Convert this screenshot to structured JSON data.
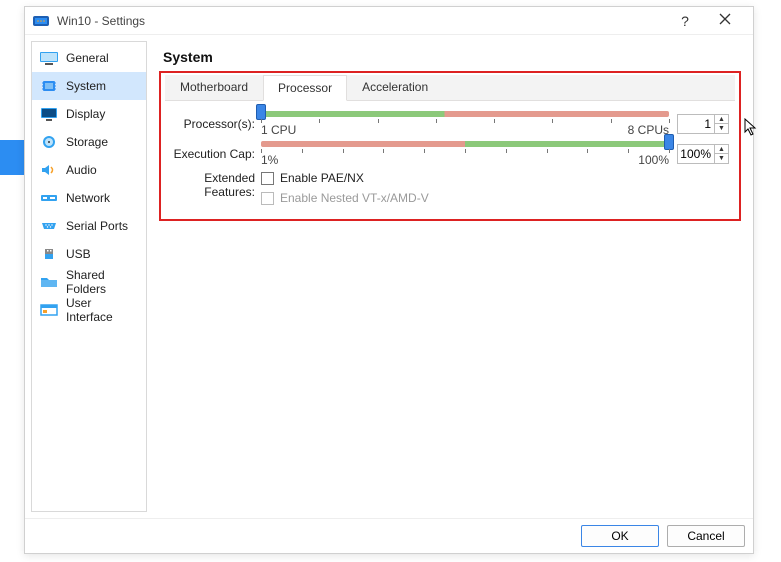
{
  "window": {
    "title": "Win10 - Settings"
  },
  "sidebar": {
    "items": [
      {
        "label": "General"
      },
      {
        "label": "System"
      },
      {
        "label": "Display"
      },
      {
        "label": "Storage"
      },
      {
        "label": "Audio"
      },
      {
        "label": "Network"
      },
      {
        "label": "Serial Ports"
      },
      {
        "label": "USB"
      },
      {
        "label": "Shared Folders"
      },
      {
        "label": "User Interface"
      }
    ]
  },
  "main": {
    "section_title": "System",
    "tabs": [
      {
        "label": "Motherboard"
      },
      {
        "label": "Processor"
      },
      {
        "label": "Acceleration"
      }
    ],
    "processor": {
      "label": "Processor(s):",
      "min_label": "1 CPU",
      "max_label": "8 CPUs",
      "value": "1"
    },
    "exec_cap": {
      "label": "Execution Cap:",
      "min_label": "1%",
      "max_label": "100%",
      "value": "100%"
    },
    "extended": {
      "label": "Extended Features:",
      "pae": "Enable PAE/NX",
      "nested": "Enable Nested VT-x/AMD-V"
    }
  },
  "footer": {
    "ok": "OK",
    "cancel": "Cancel"
  }
}
